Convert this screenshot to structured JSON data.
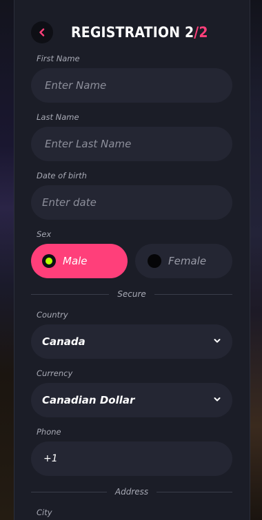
{
  "header": {
    "title_main": "REGISTRATION 2",
    "title_slash": "/",
    "title_total": "2",
    "back_icon": "chevron-left-icon"
  },
  "colors": {
    "accent": "#ff3f7a",
    "radio_selected": "#b8ff00",
    "panel": "#1b1d27",
    "field": "#242633"
  },
  "form": {
    "first_name": {
      "label": "First Name",
      "placeholder": "Enter Name"
    },
    "last_name": {
      "label": "Last Name",
      "placeholder": "Enter Last Name"
    },
    "dob": {
      "label": "Date of birth",
      "placeholder": "Enter date"
    },
    "sex": {
      "label": "Sex",
      "options": [
        {
          "label": "Male",
          "selected": true
        },
        {
          "label": "Female",
          "selected": false
        }
      ]
    },
    "secure_divider": "Secure",
    "country": {
      "label": "Country",
      "value": "Canada",
      "icon": "chevron-down-icon"
    },
    "currency": {
      "label": "Currency",
      "value": "Canadian Dollar",
      "icon": "chevron-down-icon"
    },
    "phone": {
      "label": "Phone",
      "value": "+1"
    },
    "address_divider": "Address",
    "city": {
      "label": "City"
    }
  }
}
